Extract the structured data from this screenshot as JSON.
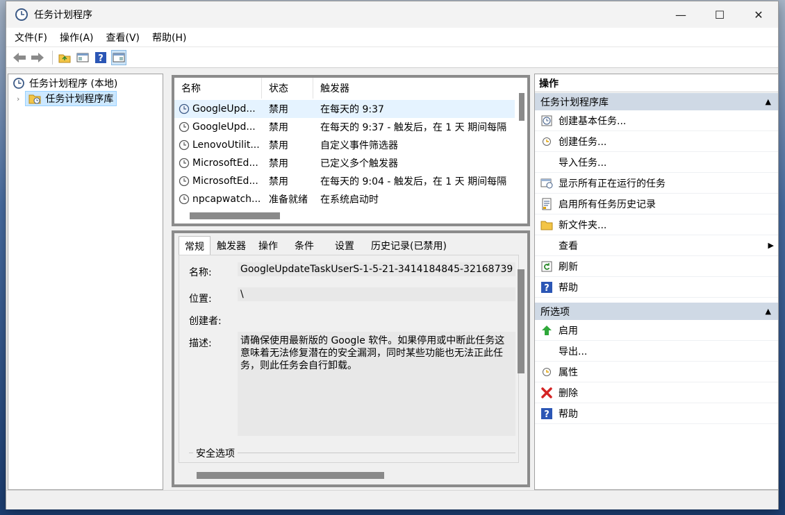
{
  "window": {
    "title": "任务计划程序",
    "minimize": "—",
    "maximize": "☐",
    "close": "✕"
  },
  "menu": [
    "文件(F)",
    "操作(A)",
    "查看(V)",
    "帮助(H)"
  ],
  "tree": {
    "root": "任务计划程序 (本地)",
    "child": "任务计划程序库"
  },
  "task_table": {
    "headers": [
      "名称",
      "状态",
      "触发器"
    ],
    "rows": [
      {
        "name": "GoogleUpd...",
        "status": "禁用",
        "trigger": "在每天的 9:37"
      },
      {
        "name": "GoogleUpd...",
        "status": "禁用",
        "trigger": "在每天的 9:37 - 触发后，在 1 天 期间每隔"
      },
      {
        "name": "LenovoUtilit...",
        "status": "禁用",
        "trigger": "自定义事件筛选器"
      },
      {
        "name": "MicrosoftEd...",
        "status": "禁用",
        "trigger": "已定义多个触发器"
      },
      {
        "name": "MicrosoftEd...",
        "status": "禁用",
        "trigger": "在每天的 9:04 - 触发后，在 1 天 期间每隔"
      },
      {
        "name": "npcapwatch...",
        "status": "准备就绪",
        "trigger": "在系统启动时"
      }
    ]
  },
  "details": {
    "tabs": [
      "常规",
      "触发器",
      "操作",
      "条件",
      "设置",
      "历史记录(已禁用)"
    ],
    "name_label": "名称:",
    "name_value": "GoogleUpdateTaskUserS-1-5-21-3414184845-32168739",
    "location_label": "位置:",
    "location_value": "\\",
    "author_label": "创建者:",
    "desc_label": "描述:",
    "desc_value": "请确保使用最新版的 Google 软件。如果停用或中断此任务这意味着无法修复潜在的安全漏洞，同时某些功能也无法正此任务，则此任务会自行卸载。",
    "security_label": "安全选项"
  },
  "actions": {
    "header": "操作",
    "section1": "任务计划程序库",
    "items1": [
      {
        "label": "创建基本任务...",
        "icon": "wizard-icon"
      },
      {
        "label": "创建任务...",
        "icon": "task-icon"
      },
      {
        "label": "导入任务...",
        "icon": ""
      },
      {
        "label": "显示所有正在运行的任务",
        "icon": "running-icon"
      },
      {
        "label": "启用所有任务历史记录",
        "icon": "history-icon"
      },
      {
        "label": "新文件夹...",
        "icon": "folder-icon"
      },
      {
        "label": "查看",
        "icon": ""
      },
      {
        "label": "刷新",
        "icon": "refresh-icon"
      },
      {
        "label": "帮助",
        "icon": "help-icon"
      }
    ],
    "section2": "所选项",
    "items2": [
      {
        "label": "启用",
        "icon": "enable-icon"
      },
      {
        "label": "导出...",
        "icon": ""
      },
      {
        "label": "属性",
        "icon": "properties-icon"
      },
      {
        "label": "删除",
        "icon": "delete-icon"
      },
      {
        "label": "帮助",
        "icon": "help-icon"
      }
    ]
  }
}
